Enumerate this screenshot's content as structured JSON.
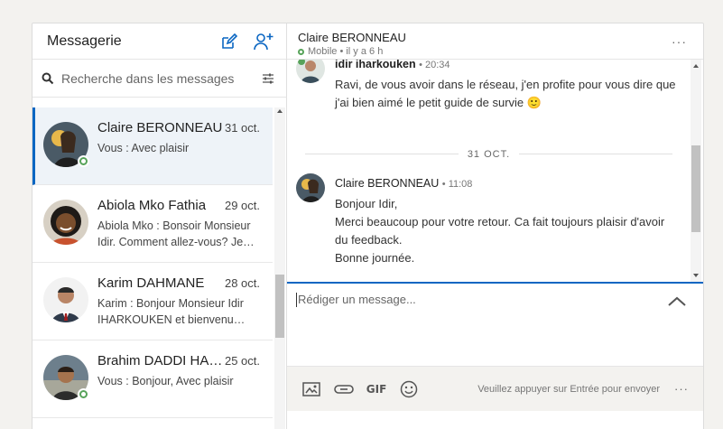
{
  "sidebar": {
    "title": "Messagerie",
    "search_placeholder": "Recherche dans les messages",
    "conversations": [
      {
        "name": "Claire BERONNEAU",
        "date": "31 oct.",
        "snippet": "Vous : Avec plaisir",
        "online": true
      },
      {
        "name": "Abiola Mko Fathia",
        "date": "29 oct.",
        "snippet": "Abiola Mko : Bonsoir Monsieur Idir. Comment allez-vous? Je…",
        "online": false
      },
      {
        "name": "Karim DAHMANE",
        "date": "28 oct.",
        "snippet": "Karim : Bonjour Monsieur Idir IHARKOUKEN et bienvenu…",
        "online": false
      },
      {
        "name": "Brahim DADDI HA…",
        "date": "25 oct.",
        "snippet": "Vous : Bonjour, Avec plaisir",
        "online": true
      }
    ]
  },
  "thread": {
    "name": "Claire BERONNEAU",
    "status": "Mobile • il y a 6 h",
    "messages": [
      {
        "sender": "idir iharkouken",
        "time": "• 20:34",
        "body": "Ravi, de vous avoir dans le réseau, j'en profite pour vous dire que j'ai bien aimé le petit guide de survie 🙂"
      },
      {
        "sender": "Claire BERONNEAU",
        "time": "• 11:08",
        "body_lines": [
          "Bonjour Idir,",
          "Merci beaucoup pour votre retour. Ca fait toujours plaisir d'avoir du feedback.",
          "Bonne journée."
        ]
      }
    ],
    "date_separator": "31 OCT."
  },
  "compose": {
    "placeholder": "Rédiger un message...",
    "gif_label": "GIF",
    "send_hint": "Veuillez appuyer sur Entrée pour envoyer",
    "menu": "···"
  },
  "header_menu": "···",
  "colors": {
    "accent": "#0a66c2",
    "online": "#57a35a",
    "active_bg": "#eef3f8"
  }
}
